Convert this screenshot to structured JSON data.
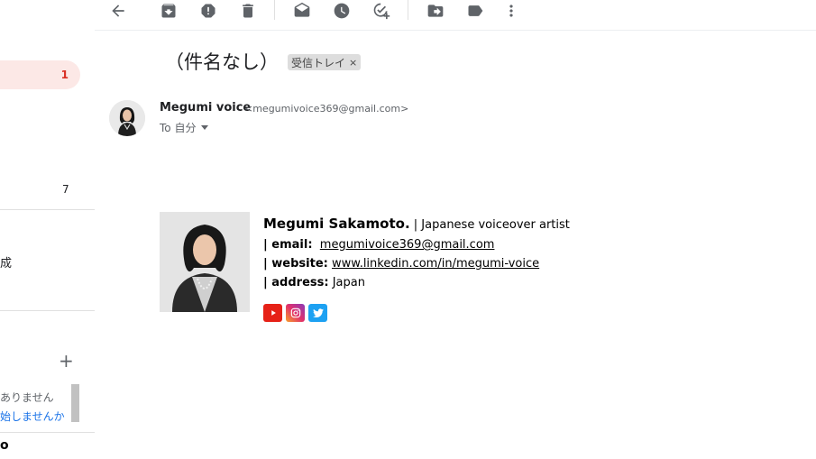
{
  "sidebar": {
    "active_count": "1",
    "count_7": "7",
    "fragment_create": "成",
    "plus": "+",
    "hangouts_line1": "ありません",
    "hangouts_line2": "始しませんか",
    "bottom_fragment": "o"
  },
  "email": {
    "subject": "（件名なし）",
    "label": "受信トレイ",
    "label_close": "×",
    "sender_name": "Megumi voice",
    "sender_email": "<megumivoice369@gmail.com>",
    "to_text": "To 自分"
  },
  "signature": {
    "name": "Megumi Sakamoto.",
    "role": " | Japanese voiceover artist",
    "email_label": "| email:",
    "email_value": "megumivoice369@gmail.com",
    "website_label": "| website:",
    "website_value": "www.linkedin.com/in/megumi-voice",
    "address_label": "| address:",
    "address_value": "Japan"
  },
  "toolbar_icons": [
    "back-arrow-icon",
    "archive-icon",
    "report-spam-icon",
    "delete-icon",
    "mark-unread-icon",
    "snooze-icon",
    "add-task-icon",
    "move-to-icon",
    "label-icon",
    "more-icon"
  ],
  "social_icons": [
    "youtube-icon",
    "instagram-icon",
    "twitter-icon"
  ],
  "colors": {
    "active_bg": "#fce8e6",
    "active_count": "#d93025",
    "link_blue": "#1a73e8",
    "youtube": "#e62117",
    "twitter": "#1da1f2"
  }
}
